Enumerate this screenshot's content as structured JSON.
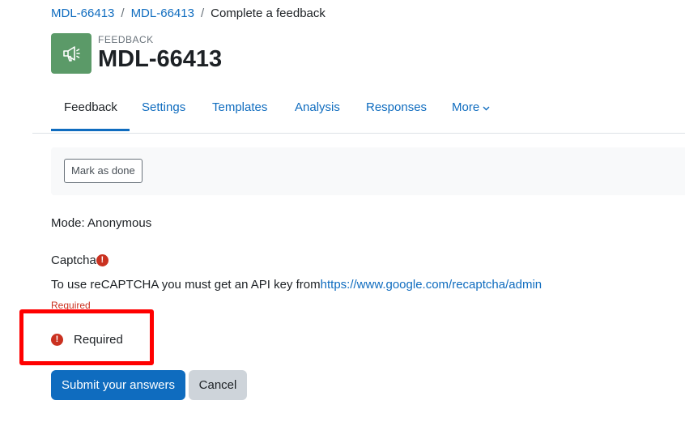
{
  "breadcrumb": {
    "items": [
      "MDL-66413",
      "MDL-66413"
    ],
    "separator": "/",
    "current": "Complete a feedback"
  },
  "header": {
    "icon": "megaphone-icon",
    "pretitle": "FEEDBACK",
    "title": "MDL-66413",
    "icon_color": "#5b9a68"
  },
  "tabs": [
    {
      "label": "Feedback",
      "active": true
    },
    {
      "label": "Settings"
    },
    {
      "label": "Templates"
    },
    {
      "label": "Analysis"
    },
    {
      "label": "Responses"
    },
    {
      "label": "More"
    }
  ],
  "action_bar": {
    "mark_done_label": "Mark as done"
  },
  "mode": "Mode: Anonymous",
  "captcha": {
    "label": "Captcha",
    "text": "To use reCAPTCHA you must get an API key from",
    "link": "https://www.google.com/recaptcha/admin",
    "required_small": "Required"
  },
  "legend": {
    "required_label": "Required"
  },
  "actions": {
    "submit_label": "Submit your answers",
    "cancel_label": "Cancel"
  },
  "colors": {
    "link": "#0f6cbf",
    "error": "#ca3120",
    "highlight": "#ff0000"
  }
}
